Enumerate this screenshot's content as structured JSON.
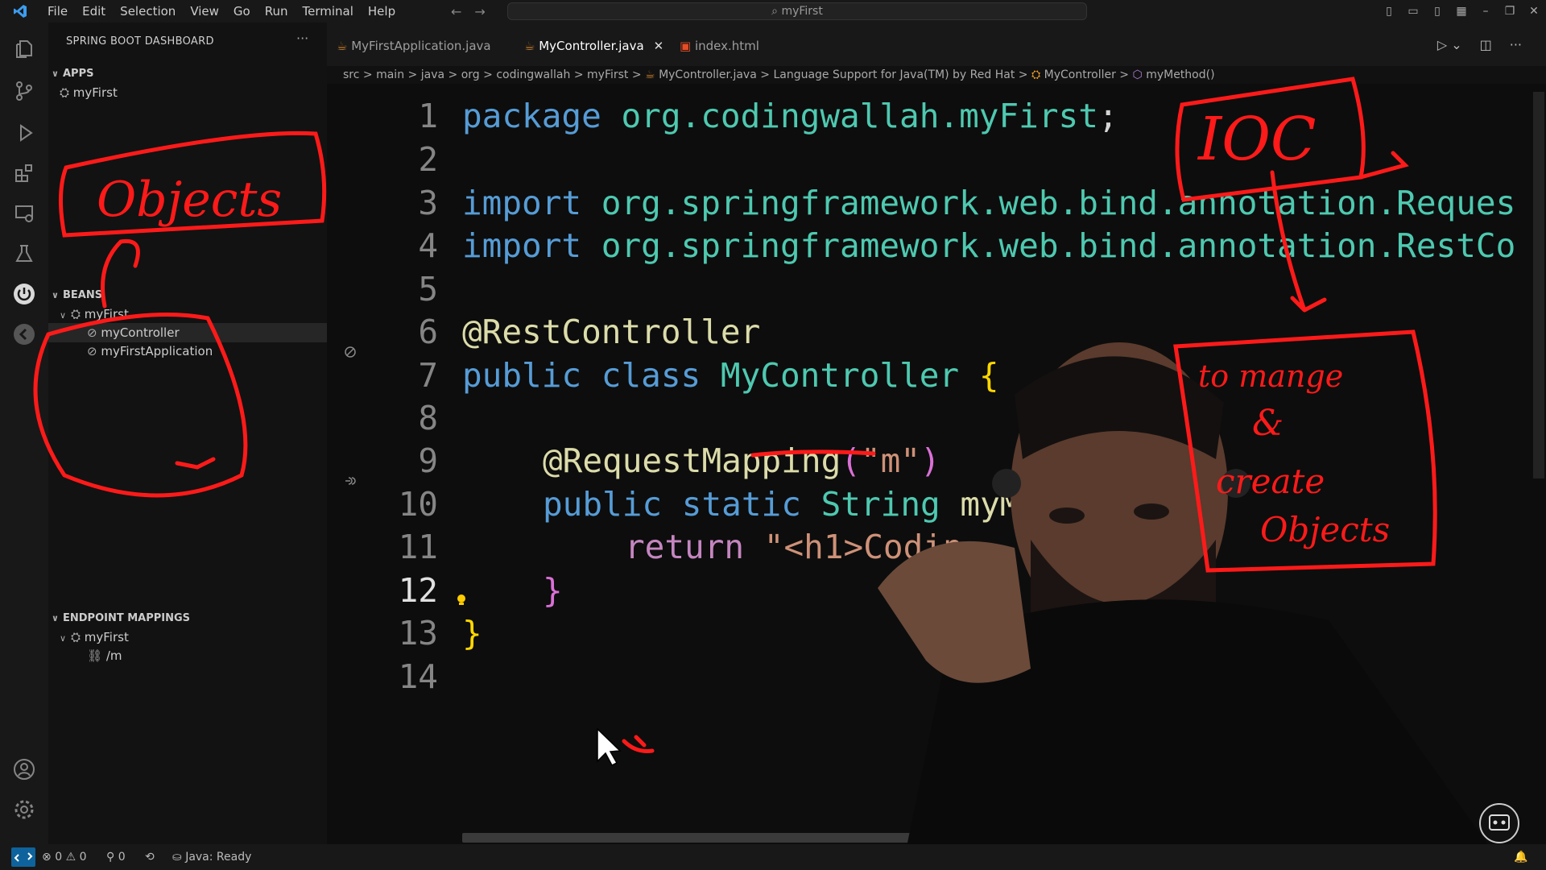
{
  "titlebar": {
    "menu": [
      "File",
      "Edit",
      "Selection",
      "View",
      "Go",
      "Run",
      "Terminal",
      "Help"
    ],
    "search": "myFirst",
    "colors": {
      "accent": "#0e639c",
      "annotation_red": "#ff1a1a"
    }
  },
  "sidebar": {
    "title": "SPRING BOOT DASHBOARD",
    "apps_header": "APPS",
    "apps": [
      "myFirst"
    ],
    "beans_header": "BEANS",
    "beans_project": "myFirst",
    "beans": [
      "myController",
      "myFirstApplication"
    ],
    "endpoints_header": "ENDPOINT MAPPINGS",
    "endpoints_project": "myFirst",
    "endpoints": [
      "/m"
    ]
  },
  "tabs": [
    {
      "label": "MyFirstApplication.java",
      "active": false
    },
    {
      "label": "MyController.java",
      "active": true
    },
    {
      "label": "index.html",
      "active": false
    }
  ],
  "breadcrumb": [
    "src",
    "main",
    "java",
    "org",
    "codingwallah",
    "myFirst",
    "MyController.java",
    "Language Support for Java(TM) by Red Hat",
    "MyController",
    "myMethod()"
  ],
  "editor": {
    "line_numbers": [
      "1",
      "2",
      "3",
      "4",
      "5",
      "6",
      "7",
      "8",
      "9",
      "10",
      "11",
      "12",
      "13",
      "14"
    ],
    "l1": {
      "kw": "package",
      "rest": "org.codingwallah.myFirst",
      "semi": ";"
    },
    "l3": {
      "kw": "import",
      "rest": "org.springframework.web.bind.annotation.Reques"
    },
    "l4": {
      "kw": "import",
      "rest": "org.springframework.web.bind.annotation.RestCo"
    },
    "l6": {
      "ann": "@RestController"
    },
    "l7": {
      "kw": "public class",
      "cls": "MyController",
      "brace": "{"
    },
    "l9": {
      "ann": "@RequestMapping",
      "open": "(",
      "str": "\"m\"",
      "close": ")"
    },
    "l10": {
      "kw": "public static",
      "type": "String",
      "name": "myM"
    },
    "l11": {
      "kw": "return",
      "str": "\"<h1>Codin"
    },
    "l12": {
      "brace": "}"
    },
    "l13": {
      "brace": "}"
    }
  },
  "annotations": {
    "objects": "Objects",
    "ioc": "IOC",
    "note_line1": "to mange",
    "note_line2": "&",
    "note_line3": "create",
    "note_line4": "Objects"
  },
  "statusbar": {
    "errors": "0",
    "warnings": "0",
    "ports": "0",
    "java": "Java: Ready"
  }
}
